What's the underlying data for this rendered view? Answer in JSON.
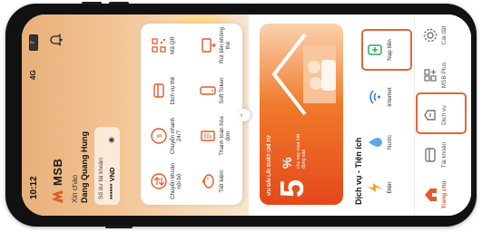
{
  "status_bar": {
    "time": "10:12",
    "network": "4G",
    "battery": "7"
  },
  "header": {
    "brand": "MSB",
    "greeting": "Xin chào",
    "user_name": "Dang Quang Hung"
  },
  "account": {
    "label": "Số dư tài khoản",
    "balance": "****** VND"
  },
  "quick_actions": [
    {
      "label": "Chuyển khoản nội bộ",
      "icon": "internal-transfer-icon"
    },
    {
      "label": "Chuyển nhanh 24/7",
      "icon": "fast-transfer-icon"
    },
    {
      "label": "Dịch vụ thẻ",
      "icon": "card-service-icon"
    },
    {
      "label": "Mã QR",
      "icon": "qr-code-icon"
    },
    {
      "label": "Tiết kiệm",
      "icon": "savings-icon"
    },
    {
      "label": "Thanh toán hóa đơn",
      "icon": "bill-payment-icon"
    },
    {
      "label": "Soft Token",
      "icon": "soft-token-icon"
    },
    {
      "label": "Rút tiền không thẻ",
      "icon": "cardless-withdraw-icon"
    }
  ],
  "promo": {
    "kicker": "ƯU ĐÃI LÃI SUẤT CHỈ TỪ",
    "rate_number": "5",
    "rate_unit": "%",
    "subtitle": "cho vay mua bất động sản"
  },
  "services": {
    "title": "Dịch vụ - Tiện ích",
    "items": [
      {
        "label": "Điện",
        "icon": "electricity-icon"
      },
      {
        "label": "Nước",
        "icon": "water-icon"
      },
      {
        "label": "Internet",
        "icon": "internet-icon"
      },
      {
        "label": "Nạp tiền",
        "icon": "top-up-icon"
      }
    ]
  },
  "tabs": [
    {
      "label": "Trang chủ",
      "icon": "home-icon"
    },
    {
      "label": "Tài khoản",
      "icon": "account-icon"
    },
    {
      "label": "Dịch vụ",
      "icon": "service-icon"
    },
    {
      "label": "MSB Plus",
      "icon": "msb-plus-icon"
    },
    {
      "label": "Cài đặt",
      "icon": "settings-icon"
    }
  ],
  "colors": {
    "brand": "#e15a28",
    "brand_dark": "#c73b16",
    "highlight": "#e2663a"
  }
}
